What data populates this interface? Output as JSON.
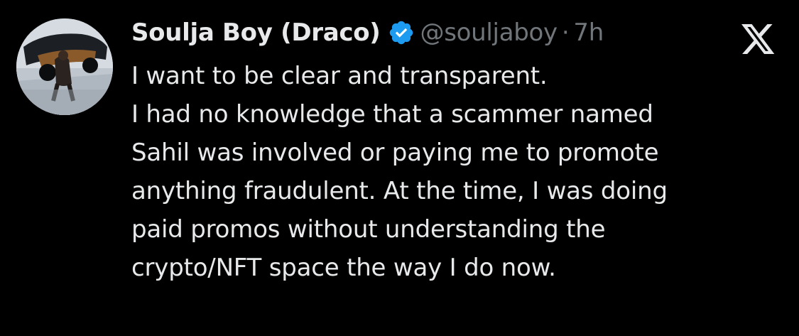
{
  "user": {
    "display_name": "Soulja Boy (Draco)",
    "handle": "@souljaboy",
    "separator": "·",
    "time": "7h",
    "avatar_icon": "profile-photo-car-avatar",
    "verified_icon": "verified-badge-icon",
    "verified_color": "#1d9bf0"
  },
  "platform": {
    "logo_icon": "x-logo-icon"
  },
  "tweet": {
    "lines": [
      "I want to be clear and transparent.",
      "I had no knowledge that a scammer named",
      "Sahil was involved or paying me to promote",
      "anything fraudulent. At the time, I was doing",
      "paid promos without understanding the",
      "crypto/NFT space the way I do now."
    ]
  },
  "colors": {
    "background": "#000000",
    "primary_text": "#e7e9ea",
    "secondary_text": "#71767b"
  }
}
